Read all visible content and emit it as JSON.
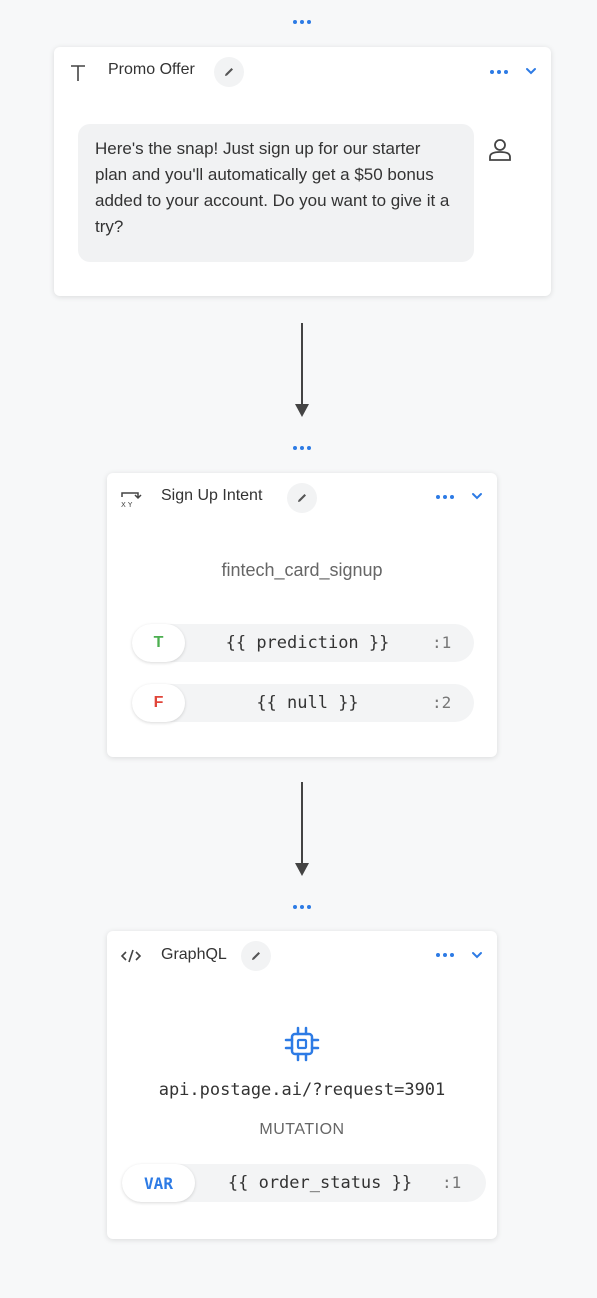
{
  "colors": {
    "accent": "#2d7be5",
    "true_green": "#4caf50",
    "false_red": "#e0453a"
  },
  "block1": {
    "icon": "text-icon",
    "title": "Promo Offer",
    "message": "Here's the snap! Just sign up for our starter plan and you'll automatically get a $50 bonus added to your account. Do you want to give it a try?",
    "speaker_icon": "user-icon"
  },
  "block2": {
    "icon": "intent-icon",
    "title": "Sign Up Intent",
    "intent_name": "fintech_card_signup",
    "paths": [
      {
        "label": "T",
        "expression": "{{ prediction }}",
        "port": ":1"
      },
      {
        "label": "F",
        "expression": "{{ null }}",
        "port": ":2"
      }
    ]
  },
  "block3": {
    "icon": "code-icon",
    "title": "GraphQL",
    "center_icon": "chip-icon",
    "endpoint": "api.postage.ai/?request=3901",
    "operation": "MUTATION",
    "var": {
      "label": "VAR",
      "expression": "{{ order_status }}",
      "port": ":1"
    }
  }
}
